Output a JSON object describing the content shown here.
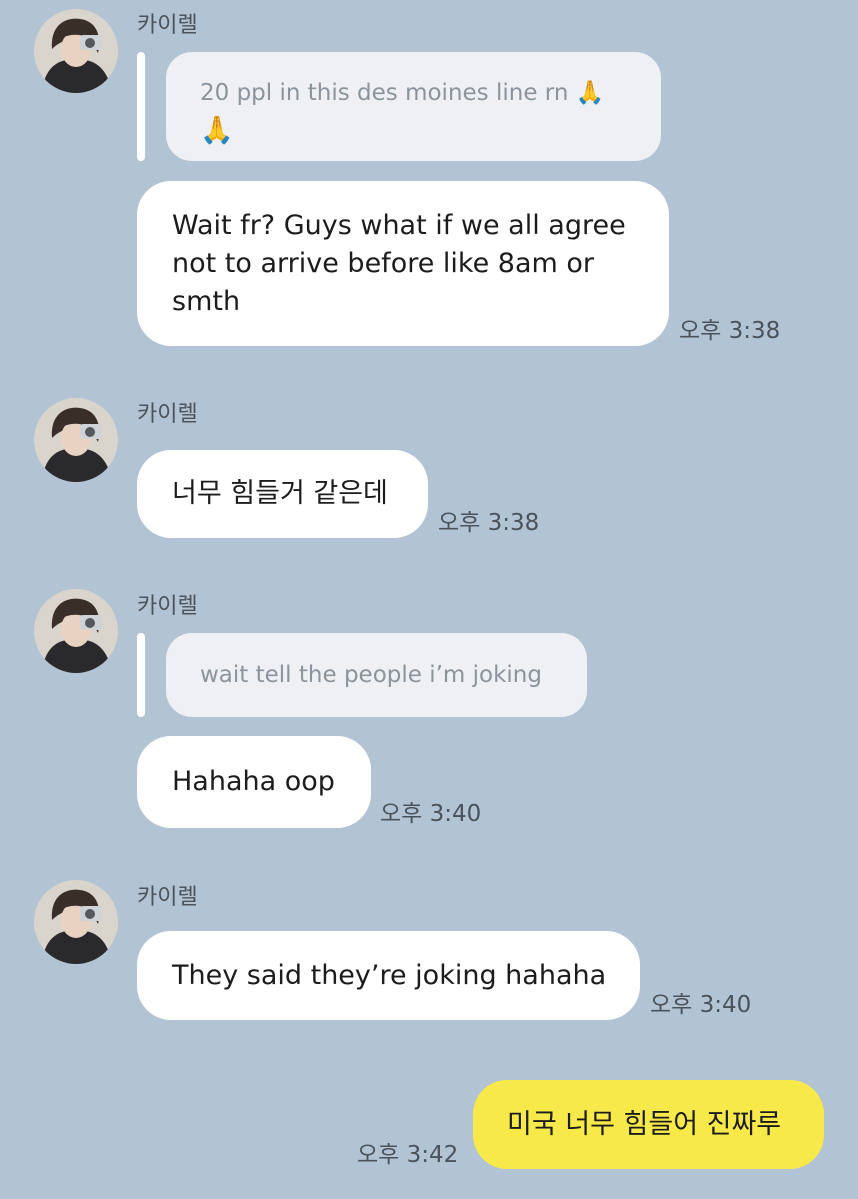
{
  "messages": [
    {
      "sender": "카이렐",
      "quote": "20 ppl in this des moines line rn 🙏",
      "quote_trailing": "🙏",
      "text": "Wait fr? Guys what if we all agree not to arrive before like 8am or smth",
      "text_lines": [
        "Wait fr? Guys what if we all agree",
        "not to arrive before like 8am or",
        "smth"
      ],
      "time": "오후 3:38"
    },
    {
      "sender": "카이렐",
      "text": "너무 힘들거 같은데",
      "time": "오후 3:38"
    },
    {
      "sender": "카이렐",
      "quote": "wait tell the people i’m joking",
      "text": "Hahaha oop",
      "time": "오후 3:40"
    },
    {
      "sender": "카이렐",
      "text": "They said they’re joking hahaha",
      "time": "오후 3:40"
    },
    {
      "sender": "me",
      "text": "미국 너무 힘들어 진짜루",
      "time": "오후 3:42"
    }
  ],
  "colors": {
    "background": "#b2c3d4",
    "incoming_bubble": "#ffffff",
    "outgoing_bubble": "#f8e94a",
    "quote_bubble": "#eef0f3"
  },
  "icons": {
    "avatar": "profile-photo-avatar",
    "pray": "folded-hands-emoji"
  }
}
